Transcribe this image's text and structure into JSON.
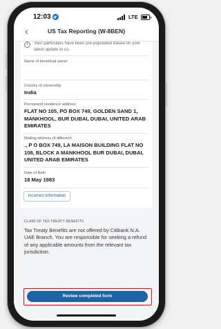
{
  "status_bar": {
    "time": "12:03",
    "network": "LTE"
  },
  "header": {
    "back_icon": "‹",
    "title": "US Tax Reporting (W-8BEN)"
  },
  "info_banner": {
    "icon": "i",
    "text": "Your particulars have been pre-populated based on your latest update to us."
  },
  "fields": [
    {
      "label": "Name of beneficial owner",
      "value": ""
    },
    {
      "label": "Country of citizenship",
      "value": "India"
    },
    {
      "label": "Permanent residence address",
      "value": "FLAT NO 105, PO BOX 749, GOLDEN SAND 1, MANKHOOL, BUR DUBAI, DUBAI, UNITED ARAB EMIRATES"
    },
    {
      "label": "Mailing address (if different)",
      "value": "., P O BOX 749, LA MAISON BUILDING FLAT NO 108, BLOCK A MANKHOOL BUR DUBAI, DUBAI, UNITED ARAB EMIRATES"
    },
    {
      "label": "Date of Birth",
      "value": "18 May 1983"
    }
  ],
  "incorrect_info_button": "Incorrect information",
  "claim": {
    "title": "CLAIM OF TAX TREATY BENEFITS",
    "text": "Tax Treaty Benefits are not offered by Citibank N.A. UAE Branch. You are responsible for seeking a refund of any applicable amounts from the relevant tax jurisdiction."
  },
  "review_button": "Review completed form",
  "colors": {
    "primary": "#1e63a6",
    "link": "#1a5fa3",
    "highlight": "#e01616",
    "location_icon": "#1a73e8"
  }
}
